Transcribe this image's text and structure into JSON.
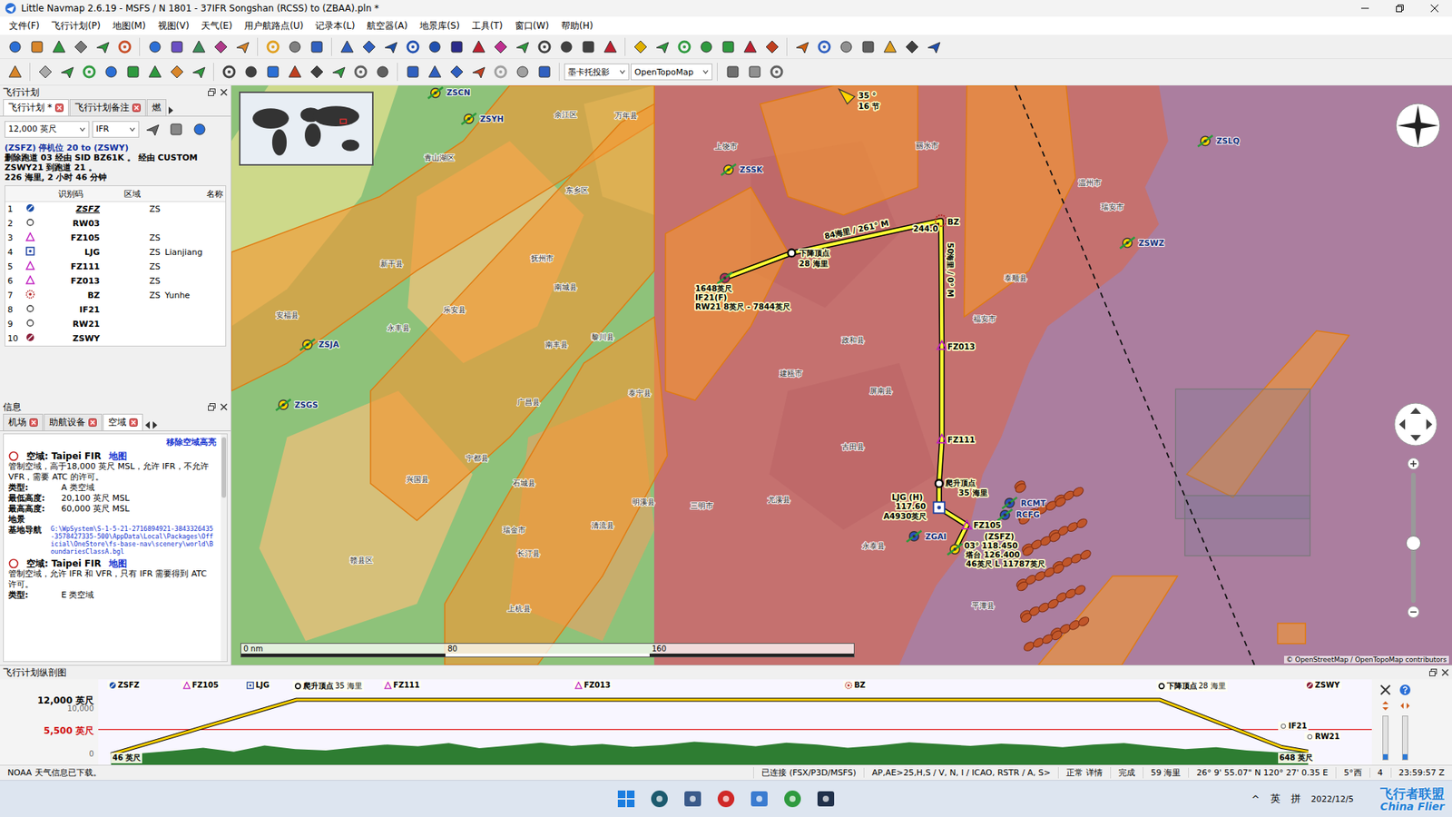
{
  "window": {
    "title": "Little Navmap 2.6.19 - MSFS / N 1801 - 37IFR Songshan (RCSS) to (ZBAA).pln *"
  },
  "menu": [
    "文件(F)",
    "飞行计划(P)",
    "地图(M)",
    "视图(V)",
    "天气(E)",
    "用户航路点(U)",
    "记录本(L)",
    "航空器(A)",
    "地景库(S)",
    "工具(T)",
    "窗口(W)",
    "帮助(H)"
  ],
  "toolbar": {
    "projection": "墨卡托投影",
    "theme": "OpenTopoMap"
  },
  "flight_plan": {
    "title": "飞行计划",
    "tabs": [
      {
        "label": "飞行计划 *",
        "selected": true
      },
      {
        "label": "飞行计划备注",
        "selected": false
      },
      {
        "label": "燃",
        "selected": false
      }
    ],
    "altitude": "12,000 英尺",
    "rules": "IFR",
    "summary": [
      "(ZSFZ) 停机位 20 to (ZSWY)",
      "删除跑道 03 经由 SID BZ61K 。 经由 CUSTOM",
      "ZSWY21 到跑道 21 。",
      "226 海里, 2 小时 46 分钟"
    ],
    "columns": [
      "识别码",
      "区域",
      "名称"
    ],
    "rows": [
      {
        "n": "1",
        "ident": "ZSFZ",
        "region": "ZS",
        "name": "",
        "kind": "airport",
        "active": true
      },
      {
        "n": "2",
        "ident": "RW03",
        "region": "",
        "name": "",
        "kind": "runway",
        "active": false
      },
      {
        "n": "3",
        "ident": "FZ105",
        "region": "ZS",
        "name": "",
        "kind": "waypoint",
        "active": false
      },
      {
        "n": "4",
        "ident": "LJG",
        "region": "ZS",
        "name": "Lianjiang",
        "kind": "vor",
        "active": false
      },
      {
        "n": "5",
        "ident": "FZ111",
        "region": "ZS",
        "name": "",
        "kind": "waypoint",
        "active": false
      },
      {
        "n": "6",
        "ident": "FZ013",
        "region": "ZS",
        "name": "",
        "kind": "waypoint",
        "active": false
      },
      {
        "n": "7",
        "ident": "BZ",
        "region": "ZS",
        "name": "Yunhe",
        "kind": "ndb",
        "active": false
      },
      {
        "n": "8",
        "ident": "IF21",
        "region": "",
        "name": "",
        "kind": "runway",
        "active": false
      },
      {
        "n": "9",
        "ident": "RW21",
        "region": "",
        "name": "",
        "kind": "runway",
        "active": false
      },
      {
        "n": "10",
        "ident": "ZSWY",
        "region": "",
        "name": "",
        "kind": "destination",
        "active": false
      }
    ]
  },
  "info": {
    "title": "信息",
    "tabs": [
      {
        "label": "机场",
        "selected": false
      },
      {
        "label": "助航设备",
        "selected": false
      },
      {
        "label": "空域",
        "selected": true
      }
    ],
    "remove_highlight": "移除空域高亮",
    "airspaces": [
      {
        "title": "空域: Taipei FIR",
        "link": "地图",
        "description": "管制空域，高于18,000 英尺 MSL，允许 IFR，不允许 VFR，需要 ATC 的许可。",
        "fields": [
          {
            "key": "类型:",
            "value": "A 类空域"
          },
          {
            "key": "最低高度:",
            "value": "20,100 英尺 MSL"
          },
          {
            "key": "最高高度:",
            "value": "60,000 英尺 MSL"
          }
        ],
        "scenery_title": "地景",
        "scenery_key": "基地导航",
        "scenery_path": "G:\\WpSystem\\S-1-5-21-2716894921-3843326435-3578427335-500\\AppData\\Local\\Packages\\Official\\OneStore\\fs-base-nav\\scenery\\world\\BoundariesClassA.bgl"
      },
      {
        "title": "空域: Taipei FIR",
        "link": "地图",
        "description": "管制空域，允许 IFR 和 VFR，只有 IFR 需要得到 ATC 许可。",
        "fields": [
          {
            "key": "类型:",
            "value": "E 类空域"
          }
        ],
        "scenery_title": "",
        "scenery_key": "",
        "scenery_path": ""
      }
    ]
  },
  "map": {
    "places": [
      "万年县",
      "余江区",
      "上饶市",
      "青山湖区",
      "东乡区",
      "抚州市",
      "新干县",
      "乐安县",
      "永丰县",
      "南城县",
      "安福县",
      "黎川县",
      "南丰县",
      "泰宁县",
      "广昌县",
      "宁都县",
      "兴国县",
      "石城县",
      "瑞金市",
      "长汀县",
      "清流县",
      "明溪县",
      "赣县区",
      "上杭县",
      "建瓯市",
      "政和县",
      "屏南县",
      "古田县",
      "尤溪县",
      "三明市",
      "永泰县",
      "平潭县",
      "福安市",
      "泰顺县",
      "瑞安市",
      "温州市",
      "丽水市"
    ],
    "airports": [
      "ZSCN",
      "ZSYH",
      "ZSSK",
      "ZSLQ",
      "ZSWZ",
      "ZSJA",
      "ZSGS",
      "ZGAI",
      "RCMT",
      "RCFG"
    ],
    "route_labels": [
      "BZ",
      "244.0",
      "84海里 / 261° M",
      "50海里 / 0° M",
      "下降顶点",
      "28 海里",
      "爬升顶点",
      "35 海里",
      "LJG (H)",
      "117.60",
      "A4930英尺",
      "FZ105",
      "FZ013",
      "FZ111",
      "(ZSFZ)",
      "03° 118.450",
      "塔台 126.400",
      "46英尺 L 11787英尺",
      "1648英尺",
      "IF21(F)",
      "RW21 8英尺 - 7844英尺"
    ],
    "wind": [
      "35 °",
      "16 节"
    ],
    "scale": [
      "0 nm",
      "80",
      "160"
    ],
    "attribution": "© OpenStreetMap / OpenTopoMap contributors",
    "zoom": {
      "level": 0.46
    }
  },
  "profile": {
    "title": "飞行计划纵剖图",
    "total_nm": 226,
    "axis": [
      {
        "label": "12,000 英尺",
        "alt": 12000,
        "kind": "cruise"
      },
      {
        "label": "10,000",
        "alt": 10000,
        "kind": "tick"
      },
      {
        "label": "5,500 英尺",
        "alt": 5500,
        "kind": "safe"
      },
      {
        "label": "0",
        "alt": 0,
        "kind": "tick"
      }
    ],
    "path": {
      "dist": [
        0,
        35,
        198,
        221,
        226
      ],
      "alt": [
        46,
        12000,
        12000,
        1648,
        648
      ]
    },
    "terrain": [
      46,
      300,
      800,
      1500,
      600,
      2000,
      1200,
      900,
      1600,
      2200,
      1800,
      2500,
      1400,
      2000,
      2600,
      1900,
      2300,
      1700,
      2100,
      2800,
      2400,
      1800,
      2600,
      2200,
      1500,
      2000,
      2700,
      2300,
      1900,
      2400,
      2100,
      1600,
      2200,
      2500,
      1800,
      1200,
      1600,
      900,
      500,
      648
    ],
    "safe_alt": 5500,
    "waypoints": [
      {
        "ident": "ZSFZ",
        "note": "",
        "dist": 0,
        "kind": "airport"
      },
      {
        "ident": "FZ105",
        "note": "",
        "dist": 14,
        "kind": "waypoint"
      },
      {
        "ident": "LJG",
        "note": "",
        "dist": 26,
        "kind": "vor"
      },
      {
        "ident": "爬升顶点",
        "note": "35 海里",
        "dist": 35,
        "kind": "toc"
      },
      {
        "ident": "FZ111",
        "note": "",
        "dist": 52,
        "kind": "waypoint"
      },
      {
        "ident": "FZ013",
        "note": "",
        "dist": 88,
        "kind": "waypoint"
      },
      {
        "ident": "BZ",
        "note": "",
        "dist": 139,
        "kind": "ndb"
      },
      {
        "ident": "下降顶点",
        "note": "28 海里",
        "dist": 198,
        "kind": "toc"
      },
      {
        "ident": "ZSWY",
        "note": "",
        "dist": 226,
        "kind": "destination"
      },
      {
        "ident": "IF21",
        "note": "",
        "dist": 221,
        "kind": "approach"
      },
      {
        "ident": "RW21",
        "note": "",
        "dist": 226,
        "kind": "approach"
      }
    ],
    "start_label": "46 英尺",
    "end_label": "648 英尺",
    "sliders": [
      {
        "level": 0.12
      },
      {
        "level": 0.12
      }
    ]
  },
  "status_bar": [
    "NOAA 天气信息已下载。",
    "已连接 (FSX/P3D/MSFS)",
    "AP,AE>25,H,S / V, N, I / ICAO, RSTR / A, S>",
    "正常 详情",
    "完成",
    "59 海里",
    "26° 9' 55.07\" N 120° 27' 0.35 E",
    "5°西",
    "4",
    "23:59:57 Z"
  ],
  "taskbar": {
    "tray": [
      "^",
      "英",
      "拼"
    ],
    "date": "2022/12/5"
  },
  "watermark": [
    "飞行者联盟",
    "China Flier"
  ]
}
